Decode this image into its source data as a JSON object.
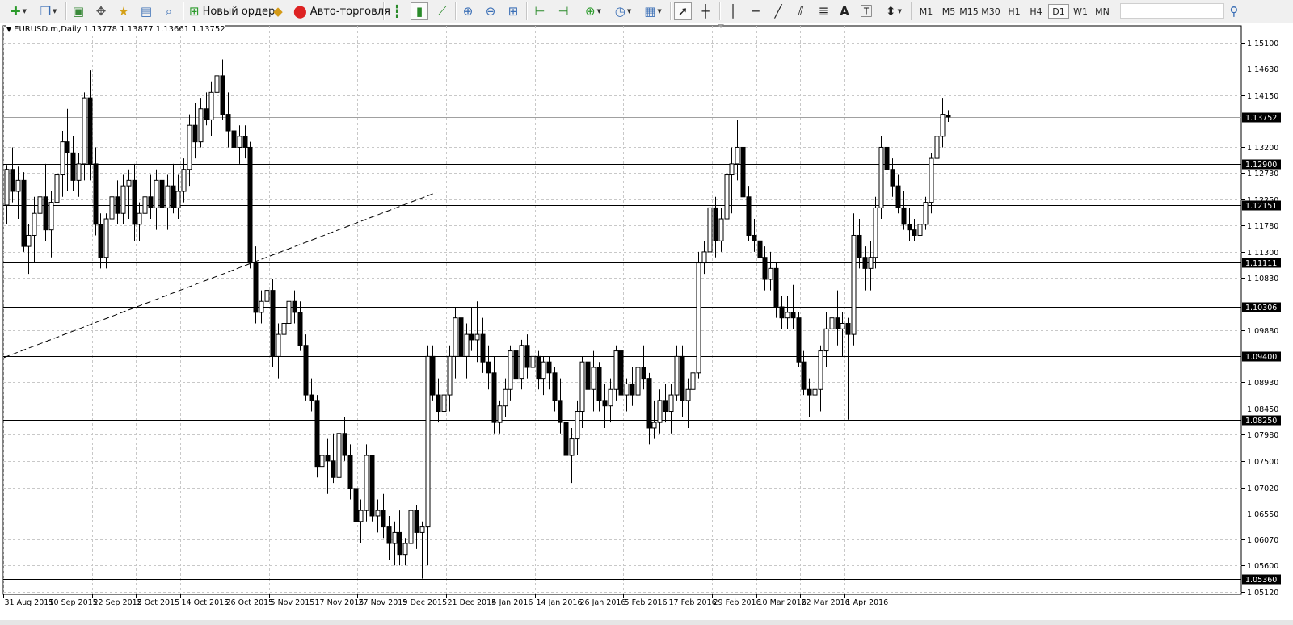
{
  "toolbar": {
    "new_order_label": "Новый ордер",
    "auto_trading_label": "Авто-торговля",
    "timeframes": [
      "M1",
      "M5",
      "M15",
      "M30",
      "H1",
      "H4",
      "D1",
      "W1",
      "MN"
    ],
    "active_timeframe": "D1",
    "icons": [
      "new-chart-icon",
      "profiles-icon",
      "market-watch-icon",
      "navigator-icon",
      "favorites-icon",
      "data-window-icon",
      "strategy-tester-icon",
      "new-order-icon",
      "metaeditor-icon",
      "auto-trading-icon",
      "bar-chart-icon",
      "candlesticks-icon",
      "line-chart-icon",
      "zoom-in-icon",
      "zoom-out-icon",
      "tile-windows-icon",
      "autoscroll-icon",
      "chart-shift-icon",
      "indicators-icon",
      "periods-icon",
      "templates-icon",
      "cursor-icon",
      "crosshair-icon",
      "vertical-line-icon",
      "horizontal-line-icon",
      "trendline-icon",
      "equidistant-channel-icon",
      "fibonacci-icon",
      "text-icon",
      "text-label-icon",
      "arrows-icon",
      "search-icon"
    ]
  },
  "chart_title": "EURUSD.m,Daily  1.13778 1.13877 1.13661 1.13752",
  "chart_data": {
    "type": "candlestick",
    "symbol": "EURUSD.m",
    "period": "Daily",
    "current_bar": {
      "open": 1.13778,
      "high": 1.13877,
      "low": 1.13661,
      "close": 1.13752
    },
    "ylim": [
      1.0512,
      1.151
    ],
    "y_ticks": [
      "1.15100",
      "1.14630",
      "1.14150",
      "1.13200",
      "1.12730",
      "1.12250",
      "1.11780",
      "1.11300",
      "1.10830",
      "1.09880",
      "1.08930",
      "1.08450",
      "1.07980",
      "1.07500",
      "1.07020",
      "1.06550",
      "1.06070",
      "1.05600",
      "1.05120"
    ],
    "x_ticks": [
      "31 Aug 2015",
      "10 Sep 2015",
      "22 Sep 2015",
      "2 Oct 2015",
      "14 Oct 2015",
      "26 Oct 2015",
      "5 Nov 2015",
      "17 Nov 2015",
      "27 Nov 2015",
      "9 Dec 2015",
      "21 Dec 2015",
      "4 Jan 2016",
      "14 Jan 2016",
      "26 Jan 2016",
      "5 Feb 2016",
      "17 Feb 2016",
      "29 Feb 2016",
      "10 Mar 2016",
      "22 Mar 2016",
      "1 Apr 2016"
    ],
    "horizontal_levels": [
      "1.12900",
      "1.12151",
      "1.11111",
      "1.10306",
      "1.09400",
      "1.08250",
      "1.05360"
    ],
    "current_price_label": "1.13752",
    "grid": true,
    "up_color": "#ffffff",
    "down_color": "#000000",
    "trendline": {
      "style": "dashed",
      "from_price": 1.0938,
      "to_price": 1.1238
    },
    "candles": [
      [
        1.1215,
        1.1288,
        1.118,
        1.128
      ],
      [
        1.128,
        1.132,
        1.122,
        1.124
      ],
      [
        1.124,
        1.1285,
        1.119,
        1.126
      ],
      [
        1.126,
        1.1275,
        1.113,
        1.114
      ],
      [
        1.114,
        1.118,
        1.109,
        1.116
      ],
      [
        1.116,
        1.123,
        1.111,
        1.12
      ],
      [
        1.12,
        1.125,
        1.116,
        1.123
      ],
      [
        1.123,
        1.129,
        1.115,
        1.117
      ],
      [
        1.117,
        1.124,
        1.112,
        1.122
      ],
      [
        1.122,
        1.132,
        1.118,
        1.127
      ],
      [
        1.127,
        1.135,
        1.123,
        1.133
      ],
      [
        1.133,
        1.139,
        1.124,
        1.131
      ],
      [
        1.131,
        1.134,
        1.124,
        1.126
      ],
      [
        1.126,
        1.131,
        1.123,
        1.129
      ],
      [
        1.129,
        1.142,
        1.126,
        1.141
      ],
      [
        1.141,
        1.146,
        1.126,
        1.129
      ],
      [
        1.129,
        1.132,
        1.116,
        1.118
      ],
      [
        1.118,
        1.12,
        1.11,
        1.112
      ],
      [
        1.112,
        1.12,
        1.11,
        1.119
      ],
      [
        1.119,
        1.125,
        1.116,
        1.123
      ],
      [
        1.123,
        1.126,
        1.118,
        1.12
      ],
      [
        1.12,
        1.127,
        1.118,
        1.125
      ],
      [
        1.125,
        1.128,
        1.119,
        1.126
      ],
      [
        1.126,
        1.129,
        1.115,
        1.118
      ],
      [
        1.118,
        1.122,
        1.115,
        1.12
      ],
      [
        1.12,
        1.126,
        1.117,
        1.123
      ],
      [
        1.123,
        1.127,
        1.119,
        1.121
      ],
      [
        1.121,
        1.128,
        1.117,
        1.126
      ],
      [
        1.126,
        1.129,
        1.12,
        1.121
      ],
      [
        1.121,
        1.127,
        1.117,
        1.125
      ],
      [
        1.125,
        1.129,
        1.12,
        1.121
      ],
      [
        1.121,
        1.127,
        1.119,
        1.124
      ],
      [
        1.124,
        1.13,
        1.122,
        1.128
      ],
      [
        1.128,
        1.138,
        1.125,
        1.136
      ],
      [
        1.136,
        1.14,
        1.13,
        1.133
      ],
      [
        1.133,
        1.141,
        1.132,
        1.139
      ],
      [
        1.139,
        1.142,
        1.136,
        1.137
      ],
      [
        1.137,
        1.144,
        1.134,
        1.142
      ],
      [
        1.142,
        1.147,
        1.139,
        1.145
      ],
      [
        1.145,
        1.148,
        1.137,
        1.138
      ],
      [
        1.138,
        1.142,
        1.132,
        1.135
      ],
      [
        1.135,
        1.138,
        1.131,
        1.132
      ],
      [
        1.132,
        1.136,
        1.129,
        1.134
      ],
      [
        1.134,
        1.136,
        1.13,
        1.132
      ],
      [
        1.132,
        1.133,
        1.11,
        1.111
      ],
      [
        1.111,
        1.114,
        1.1,
        1.102
      ],
      [
        1.102,
        1.106,
        1.1,
        1.104
      ],
      [
        1.104,
        1.108,
        1.102,
        1.106
      ],
      [
        1.106,
        1.108,
        1.092,
        1.094
      ],
      [
        1.094,
        1.1,
        1.09,
        1.098
      ],
      [
        1.098,
        1.102,
        1.095,
        1.1
      ],
      [
        1.1,
        1.105,
        1.098,
        1.104
      ],
      [
        1.104,
        1.106,
        1.1,
        1.102
      ],
      [
        1.102,
        1.104,
        1.095,
        1.096
      ],
      [
        1.096,
        1.098,
        1.086,
        1.087
      ],
      [
        1.087,
        1.09,
        1.084,
        1.086
      ],
      [
        1.086,
        1.087,
        1.072,
        1.074
      ],
      [
        1.074,
        1.078,
        1.07,
        1.076
      ],
      [
        1.076,
        1.079,
        1.069,
        1.075
      ],
      [
        1.075,
        1.08,
        1.071,
        1.072
      ],
      [
        1.072,
        1.082,
        1.07,
        1.08
      ],
      [
        1.08,
        1.083,
        1.075,
        1.076
      ],
      [
        1.076,
        1.078,
        1.068,
        1.07
      ],
      [
        1.07,
        1.072,
        1.062,
        1.064
      ],
      [
        1.064,
        1.068,
        1.06,
        1.066
      ],
      [
        1.066,
        1.078,
        1.064,
        1.076
      ],
      [
        1.076,
        1.076,
        1.064,
        1.065
      ],
      [
        1.065,
        1.068,
        1.062,
        1.066
      ],
      [
        1.066,
        1.069,
        1.061,
        1.063
      ],
      [
        1.063,
        1.065,
        1.057,
        1.06
      ],
      [
        1.06,
        1.064,
        1.056,
        1.062
      ],
      [
        1.062,
        1.066,
        1.056,
        1.058
      ],
      [
        1.058,
        1.061,
        1.056,
        1.06
      ],
      [
        1.06,
        1.068,
        1.057,
        1.066
      ],
      [
        1.066,
        1.067,
        1.059,
        1.062
      ],
      [
        1.062,
        1.064,
        1.0536,
        1.063
      ],
      [
        1.063,
        1.096,
        1.056,
        1.094
      ],
      [
        1.094,
        1.096,
        1.086,
        1.087
      ],
      [
        1.087,
        1.09,
        1.082,
        1.084
      ],
      [
        1.084,
        1.089,
        1.082,
        1.087
      ],
      [
        1.087,
        1.096,
        1.084,
        1.094
      ],
      [
        1.094,
        1.103,
        1.09,
        1.101
      ],
      [
        1.101,
        1.105,
        1.092,
        1.094
      ],
      [
        1.094,
        1.1,
        1.09,
        1.098
      ],
      [
        1.098,
        1.103,
        1.095,
        1.097
      ],
      [
        1.097,
        1.104,
        1.093,
        1.098
      ],
      [
        1.098,
        1.101,
        1.091,
        1.093
      ],
      [
        1.093,
        1.096,
        1.088,
        1.091
      ],
      [
        1.091,
        1.094,
        1.08,
        1.082
      ],
      [
        1.082,
        1.086,
        1.08,
        1.085
      ],
      [
        1.085,
        1.09,
        1.083,
        1.088
      ],
      [
        1.088,
        1.096,
        1.086,
        1.095
      ],
      [
        1.095,
        1.098,
        1.088,
        1.09
      ],
      [
        1.09,
        1.097,
        1.088,
        1.096
      ],
      [
        1.096,
        1.098,
        1.09,
        1.092
      ],
      [
        1.092,
        1.096,
        1.089,
        1.094
      ],
      [
        1.094,
        1.095,
        1.088,
        1.09
      ],
      [
        1.09,
        1.094,
        1.087,
        1.093
      ],
      [
        1.093,
        1.094,
        1.088,
        1.091
      ],
      [
        1.091,
        1.092,
        1.084,
        1.086
      ],
      [
        1.086,
        1.09,
        1.08,
        1.082
      ],
      [
        1.082,
        1.083,
        1.072,
        1.076
      ],
      [
        1.076,
        1.081,
        1.071,
        1.079
      ],
      [
        1.079,
        1.086,
        1.076,
        1.084
      ],
      [
        1.084,
        1.094,
        1.081,
        1.093
      ],
      [
        1.093,
        1.094,
        1.086,
        1.088
      ],
      [
        1.088,
        1.095,
        1.084,
        1.092
      ],
      [
        1.092,
        1.093,
        1.084,
        1.086
      ],
      [
        1.086,
        1.089,
        1.081,
        1.085
      ],
      [
        1.085,
        1.09,
        1.082,
        1.088
      ],
      [
        1.088,
        1.096,
        1.086,
        1.095
      ],
      [
        1.095,
        1.096,
        1.084,
        1.087
      ],
      [
        1.087,
        1.09,
        1.084,
        1.089
      ],
      [
        1.089,
        1.092,
        1.085,
        1.087
      ],
      [
        1.087,
        1.095,
        1.086,
        1.092
      ],
      [
        1.092,
        1.096,
        1.088,
        1.09
      ],
      [
        1.09,
        1.091,
        1.078,
        1.081
      ],
      [
        1.081,
        1.086,
        1.079,
        1.082
      ],
      [
        1.082,
        1.088,
        1.08,
        1.086
      ],
      [
        1.086,
        1.089,
        1.082,
        1.084
      ],
      [
        1.084,
        1.089,
        1.08,
        1.087
      ],
      [
        1.087,
        1.096,
        1.086,
        1.094
      ],
      [
        1.094,
        1.096,
        1.083,
        1.086
      ],
      [
        1.086,
        1.09,
        1.081,
        1.088
      ],
      [
        1.088,
        1.094,
        1.085,
        1.091
      ],
      [
        1.091,
        1.113,
        1.09,
        1.111
      ],
      [
        1.111,
        1.115,
        1.109,
        1.113
      ],
      [
        1.113,
        1.124,
        1.111,
        1.121
      ],
      [
        1.121,
        1.123,
        1.112,
        1.115
      ],
      [
        1.115,
        1.121,
        1.113,
        1.119
      ],
      [
        1.119,
        1.128,
        1.116,
        1.127
      ],
      [
        1.127,
        1.132,
        1.12,
        1.129
      ],
      [
        1.129,
        1.137,
        1.126,
        1.132
      ],
      [
        1.132,
        1.134,
        1.12,
        1.123
      ],
      [
        1.123,
        1.125,
        1.115,
        1.116
      ],
      [
        1.116,
        1.119,
        1.113,
        1.115
      ],
      [
        1.115,
        1.117,
        1.11,
        1.112
      ],
      [
        1.112,
        1.114,
        1.106,
        1.108
      ],
      [
        1.108,
        1.113,
        1.106,
        1.11
      ],
      [
        1.11,
        1.111,
        1.101,
        1.103
      ],
      [
        1.103,
        1.105,
        1.099,
        1.101
      ],
      [
        1.101,
        1.105,
        1.099,
        1.102
      ],
      [
        1.102,
        1.107,
        1.099,
        1.101
      ],
      [
        1.101,
        1.102,
        1.092,
        1.093
      ],
      [
        1.093,
        1.095,
        1.087,
        1.088
      ],
      [
        1.088,
        1.09,
        1.083,
        1.087
      ],
      [
        1.087,
        1.089,
        1.084,
        1.088
      ],
      [
        1.088,
        1.096,
        1.084,
        1.095
      ],
      [
        1.095,
        1.102,
        1.092,
        1.099
      ],
      [
        1.099,
        1.105,
        1.095,
        1.101
      ],
      [
        1.101,
        1.106,
        1.096,
        1.099
      ],
      [
        1.099,
        1.102,
        1.094,
        1.1
      ],
      [
        1.1,
        1.101,
        1.0825,
        1.098
      ],
      [
        1.098,
        1.12,
        1.096,
        1.116
      ],
      [
        1.116,
        1.119,
        1.11,
        1.112
      ],
      [
        1.112,
        1.114,
        1.106,
        1.11
      ],
      [
        1.11,
        1.115,
        1.106,
        1.112
      ],
      [
        1.112,
        1.123,
        1.11,
        1.121
      ],
      [
        1.121,
        1.134,
        1.119,
        1.132
      ],
      [
        1.132,
        1.135,
        1.126,
        1.128
      ],
      [
        1.128,
        1.13,
        1.123,
        1.125
      ],
      [
        1.125,
        1.127,
        1.12,
        1.121
      ],
      [
        1.121,
        1.124,
        1.117,
        1.118
      ],
      [
        1.118,
        1.121,
        1.115,
        1.117
      ],
      [
        1.117,
        1.119,
        1.115,
        1.116
      ],
      [
        1.116,
        1.119,
        1.114,
        1.118
      ],
      [
        1.118,
        1.123,
        1.117,
        1.122
      ],
      [
        1.122,
        1.131,
        1.12,
        1.13
      ],
      [
        1.13,
        1.136,
        1.128,
        1.134
      ],
      [
        1.134,
        1.141,
        1.132,
        1.138
      ],
      [
        1.13778,
        1.13877,
        1.13661,
        1.13752
      ]
    ]
  }
}
